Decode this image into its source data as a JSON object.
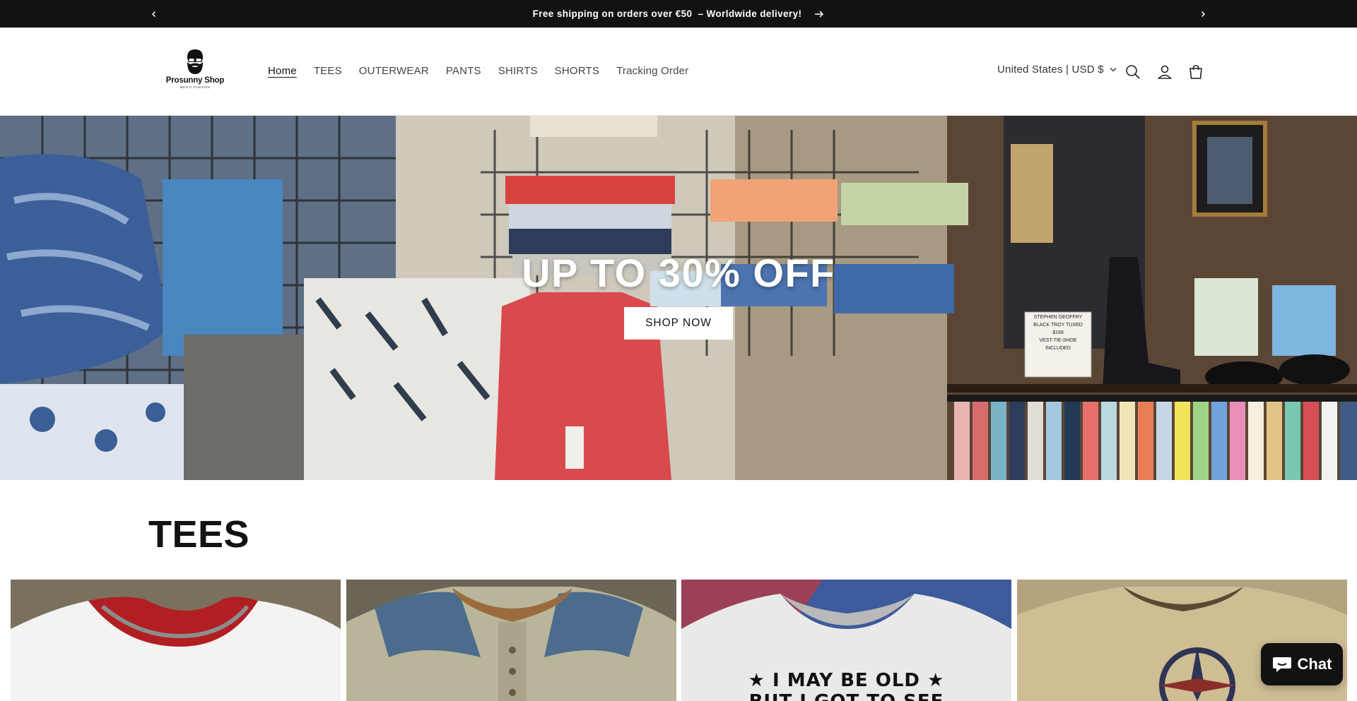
{
  "announcement": {
    "message": "Free shipping on orders over €50",
    "message_suffix": "– Worldwide delivery!",
    "prev_icon": "chevron-left-icon",
    "next_icon": "chevron-right-icon"
  },
  "header": {
    "logo": {
      "brand": "Prosunny Shop",
      "tagline": "MEN'S FASHION"
    },
    "nav": [
      "Home",
      "TEES",
      "OUTERWEAR",
      "PANTS",
      "SHIRTS",
      "SHORTS",
      "Tracking Order"
    ],
    "active_nav": "Home",
    "locale": "United States | USD $",
    "icons": [
      "search-icon",
      "account-icon",
      "cart-icon"
    ]
  },
  "hero": {
    "title": "UP TO 30% OFF",
    "button": "SHOP NOW",
    "shelf_sign": [
      "STEPHEN GEOFFRY",
      "BLACK TROY TUXED",
      "$199",
      "VEST-TIE-SHOE",
      "INCLUDED"
    ]
  },
  "collection": {
    "title": "TEES",
    "product_shirt_text": [
      "★ I MAY BE OLD ★",
      "BUT I GOT TO SEE"
    ]
  },
  "chat": {
    "label": "Chat",
    "icon": "chat-bubble-icon"
  },
  "colors": {
    "announcement_bg": "#121212",
    "text": "#121212",
    "button_bg": "#ffffff",
    "chat_bg": "#121212"
  }
}
